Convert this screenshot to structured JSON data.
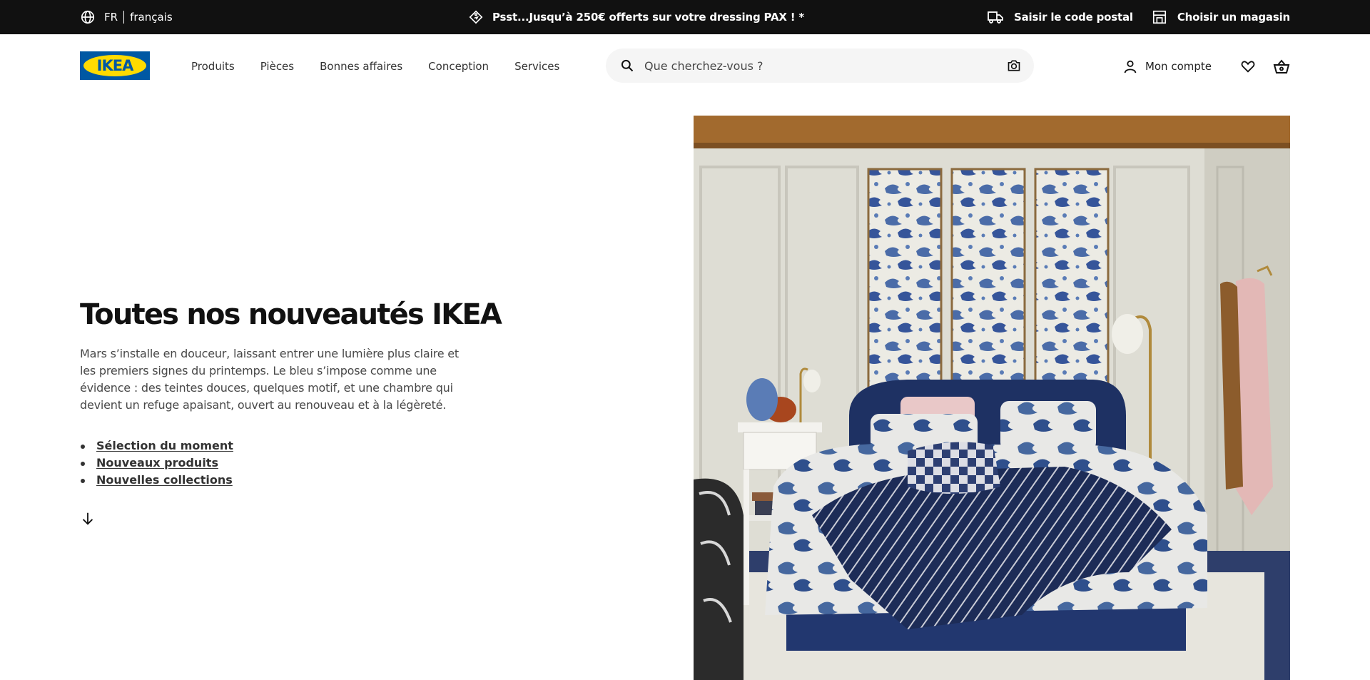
{
  "topbar": {
    "lang_code": "FR",
    "lang_name": "français",
    "promo": "Psst...Jusqu’à 250€ offerts sur votre dressing PAX ! *",
    "postal_label": "Saisir le code postal",
    "store_label": "Choisir un magasin"
  },
  "header": {
    "logo_text": "IKEA",
    "nav": [
      "Produits",
      "Pièces",
      "Bonnes affaires",
      "Conception",
      "Services"
    ],
    "search_placeholder": "Que cherchez-vous ?",
    "account_label": "Mon compte"
  },
  "hero": {
    "title": "Toutes nos nouveautés IKEA",
    "description": "Mars s’installe en douceur, laissant entrer une lumière plus claire et les premiers signes du printemps. Le bleu s’impose comme une évidence : des teintes douces, quelques motif, et une chambre qui devient un refuge apaisant, ouvert au renouveau et à la légèreté.",
    "links": [
      "Sélection du moment",
      "Nouveaux produits",
      "Nouvelles collections"
    ]
  },
  "colors": {
    "topbar_bg": "#111111",
    "ikea_blue": "#0058a3",
    "ikea_yellow": "#ffdb00",
    "search_bg": "#f5f5f5"
  },
  "icons": [
    "globe-icon",
    "price-tag-icon",
    "delivery-truck-icon",
    "store-icon",
    "search-icon",
    "camera-icon",
    "person-icon",
    "heart-icon",
    "shopping-basket-icon",
    "arrow-down-icon"
  ]
}
